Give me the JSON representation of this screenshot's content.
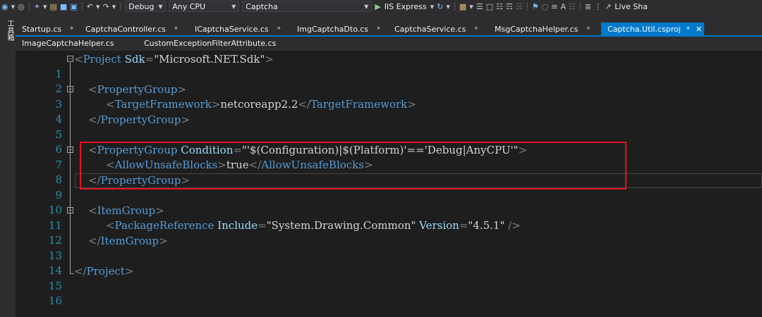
{
  "toolbar": {
    "config_value": "Debug",
    "platform_value": "Any CPU",
    "project_value": "Captcha",
    "run_label": "IIS Express",
    "live_share_label": "Live Sha"
  },
  "left_strip": {
    "label": "工具箱"
  },
  "tabs": [
    {
      "label": "Startup.cs"
    },
    {
      "label": "CaptchaController.cs"
    },
    {
      "label": "ICaptchaService.cs"
    },
    {
      "label": "ImgCaptchaDto.cs"
    },
    {
      "label": "CaptchaService.cs"
    },
    {
      "label": "MsgCaptchaHelper.cs"
    },
    {
      "label": "Captcha.Util.csproj"
    },
    {
      "label": "ImageCaptchaHelper.cs"
    },
    {
      "label": "CustomExceptionFilterAttribute.cs"
    }
  ],
  "editor": {
    "line_numbers": [
      "1",
      "2",
      "3",
      "4",
      "5",
      "6",
      "7",
      "8",
      "9",
      "10",
      "11",
      "12",
      "13",
      "14",
      "15",
      "16"
    ],
    "tokens": {
      "project": "Project",
      "sdk_attr": "Sdk",
      "sdk_value": "\"Microsoft.NET.Sdk\"",
      "property_group": "PropertyGroup",
      "target_framework": "TargetFramework",
      "target_framework_value": "netcoreapp2.2",
      "condition_attr": "Condition",
      "condition_value": "\"'$(Configuration)|$(Platform)'=='Debug|AnyCPU'\"",
      "allow_unsafe": "AllowUnsafeBlocks",
      "allow_unsafe_value": "true",
      "item_group": "ItemGroup",
      "package_reference": "PackageReference",
      "include_attr": "Include",
      "include_value": "\"System.Drawing.Common\"",
      "version_attr": "Version",
      "version_value": "\"4.5.1\""
    }
  }
}
